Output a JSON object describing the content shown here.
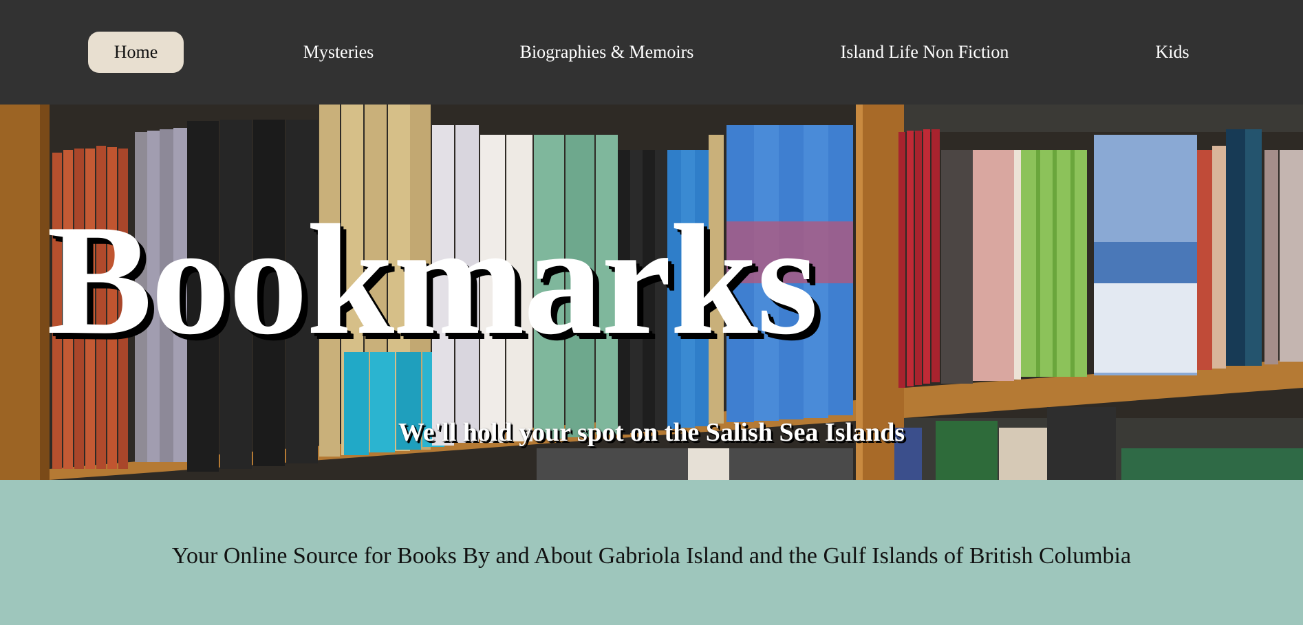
{
  "nav": {
    "items": [
      {
        "label": "Home",
        "active": true
      },
      {
        "label": "Mysteries",
        "active": false
      },
      {
        "label": "Biographies & Memoirs",
        "active": false
      },
      {
        "label": "Island Life Non Fiction",
        "active": false
      },
      {
        "label": "Kids",
        "active": false
      }
    ]
  },
  "hero": {
    "title": "Bookmarks",
    "tagline": "We'll hold your spot on the Salish Sea Islands",
    "image_subject": "bookshelf-photo"
  },
  "intro": {
    "text": "Your Online Source for Books By and About Gabriola Island and the Gulf Islands of British Columbia"
  },
  "colors": {
    "nav_background": "#323232",
    "nav_active_background": "#e8dfd0",
    "intro_background": "#9ec6bc",
    "shelf_wood": "#a86a28"
  }
}
